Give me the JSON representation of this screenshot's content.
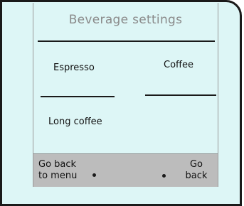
{
  "screen": {
    "title": "Beverage settings"
  },
  "options": {
    "espresso": "Espresso",
    "coffee": "Coffee",
    "long_coffee": "Long coffee"
  },
  "footer": {
    "back_to_menu_line1": "Go back",
    "back_to_menu_line2": "to menu",
    "go_back_line1": "Go",
    "go_back_line2": "back"
  }
}
